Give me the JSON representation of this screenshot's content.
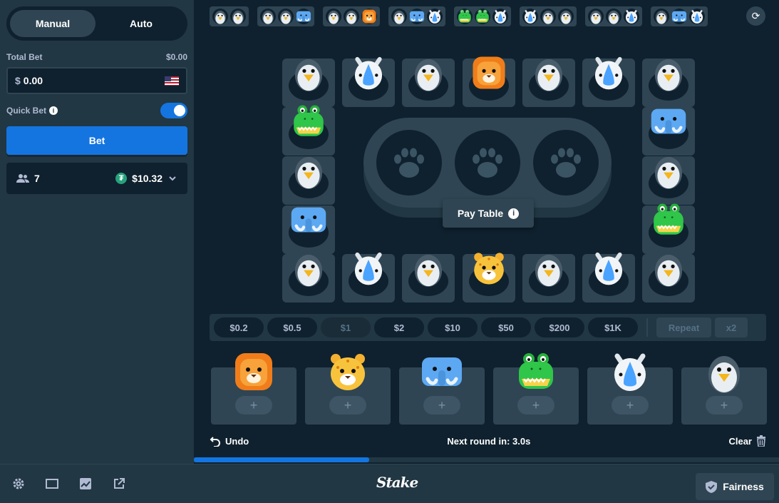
{
  "sidebar": {
    "tabs": [
      {
        "label": "Manual"
      },
      {
        "label": "Auto"
      }
    ],
    "total_bet_label": "Total Bet",
    "total_bet_value": "$0.00",
    "bet_currency": "$",
    "bet_amount": "0.00",
    "quick_bet_label": "Quick Bet",
    "quick_bet_on": true,
    "bet_button": "Bet",
    "player_count": "7",
    "pot_amount": "$10.32"
  },
  "history": [
    [
      "penguin",
      "penguin"
    ],
    [
      "penguin",
      "penguin",
      "elephant"
    ],
    [
      "penguin",
      "penguin",
      "lion"
    ],
    [
      "penguin",
      "elephant",
      "rhino"
    ],
    [
      "croc",
      "croc",
      "rhino"
    ],
    [
      "rhino",
      "penguin",
      "penguin"
    ],
    [
      "penguin",
      "penguin",
      "rhino"
    ],
    [
      "penguin",
      "elephant",
      "rhino"
    ]
  ],
  "board": {
    "top": [
      "penguin",
      "rhino",
      "penguin",
      "lion",
      "penguin",
      "rhino",
      "penguin"
    ],
    "left": [
      "croc",
      "penguin",
      "elephant"
    ],
    "right": [
      "elephant",
      "penguin",
      "croc"
    ],
    "bottom": [
      "penguin",
      "rhino",
      "penguin",
      "tiger",
      "penguin",
      "rhino",
      "penguin"
    ],
    "paytable_label": "Pay Table"
  },
  "chips": [
    "$0.2",
    "$0.5",
    "$1",
    "$2",
    "$10",
    "$50",
    "$200",
    "$1K"
  ],
  "chip_actions": [
    "Repeat",
    "x2"
  ],
  "bet_slots": [
    "lion",
    "tiger",
    "elephant",
    "croc",
    "rhino",
    "penguin"
  ],
  "bottom": {
    "undo_label": "Undo",
    "next_round": "Next round in: 3.0s",
    "clear_label": "Clear",
    "progress": 0.3
  },
  "footer": {
    "logo": "Stake",
    "fairness_label": "Fairness"
  },
  "colors": {
    "accent": "#1475e1",
    "panel": "#213743",
    "bg": "#0f212e"
  }
}
